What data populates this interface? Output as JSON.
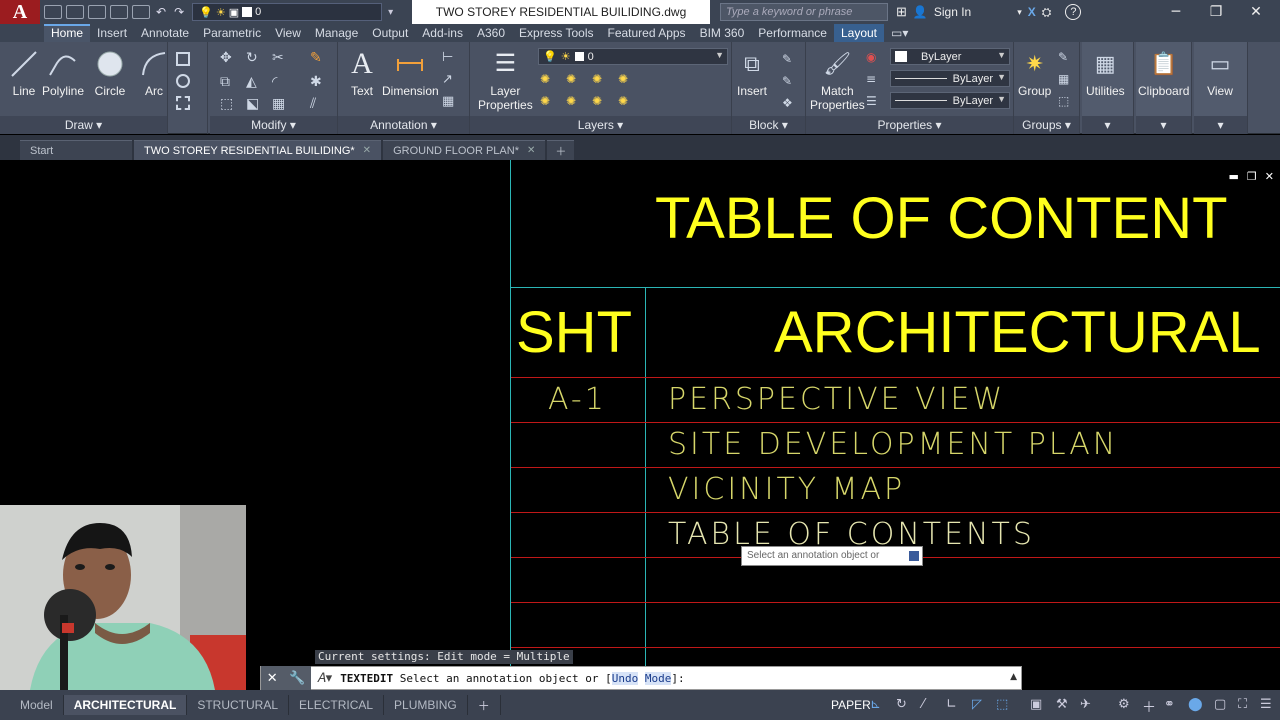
{
  "titlebar": {
    "logo": "A",
    "layer_current": "0",
    "document_title": "TWO STOREY RESIDENTIAL BUILIDING.dwg",
    "search_placeholder": "Type a keyword or phrase",
    "sign_in": "Sign In",
    "help": "?"
  },
  "ribbon_tabs": [
    "Home",
    "Insert",
    "Annotate",
    "Parametric",
    "View",
    "Manage",
    "Output",
    "Add-ins",
    "A360",
    "Express Tools",
    "Featured Apps",
    "BIM 360",
    "Performance",
    "Layout"
  ],
  "ribbon": {
    "draw": {
      "title": "Draw",
      "line": "Line",
      "polyline": "Polyline",
      "circle": "Circle",
      "arc": "Arc"
    },
    "modify": {
      "title": "Modify"
    },
    "annotation": {
      "title": "Annotation",
      "text": "Text",
      "dimension": "Dimension"
    },
    "layers": {
      "title": "Layers",
      "layer_properties_1": "Layer",
      "layer_properties_2": "Properties",
      "layer_value": "0"
    },
    "block": {
      "title": "Block",
      "insert": "Insert"
    },
    "properties": {
      "title": "Properties",
      "match_1": "Match",
      "match_2": "Properties",
      "color": "ByLayer",
      "linetype": "ByLayer",
      "lineweight": "ByLayer"
    },
    "groups": {
      "title": "Groups",
      "group": "Group"
    },
    "utilities": "Utilities",
    "clipboard": "Clipboard",
    "view": "View"
  },
  "file_tabs": [
    {
      "label": "Start"
    },
    {
      "label": "TWO STOREY RESIDENTIAL BUILIDING*"
    },
    {
      "label": "GROUND FLOOR PLAN*"
    }
  ],
  "drawing": {
    "heading": "TABLE OF CONTENT",
    "col_sht": "SHT",
    "col_arch": "ARCHITECTURAL",
    "rows": [
      {
        "sheet": "A-1",
        "title": "PERSPECTIVE VIEW"
      },
      {
        "sheet": "",
        "title": "SITE DEVELOPMENT PLAN"
      },
      {
        "sheet": "",
        "title": "VICINITY MAP"
      },
      {
        "sheet": "",
        "title": "TABLE OF CONTENTS"
      }
    ],
    "tooltip": "Select an annotation object or"
  },
  "command": {
    "history": "Current settings: Edit mode = Multiple",
    "prompt_cmd": "TEXTEDIT",
    "prompt_text": "Select an annotation object or [",
    "undo": "Undo",
    "mode": "Mode",
    "prompt_end": "]:"
  },
  "layout_tabs": [
    "Model",
    "ARCHITECTURAL",
    "STRUCTURAL",
    "ELECTRICAL",
    "PLUMBING"
  ],
  "status": {
    "paper": "PAPER"
  },
  "colors": {
    "accent": "#38608f",
    "cad_yellow": "#ffff1e",
    "cad_red": "#c01818",
    "cad_cyan": "#2bb5b5"
  }
}
